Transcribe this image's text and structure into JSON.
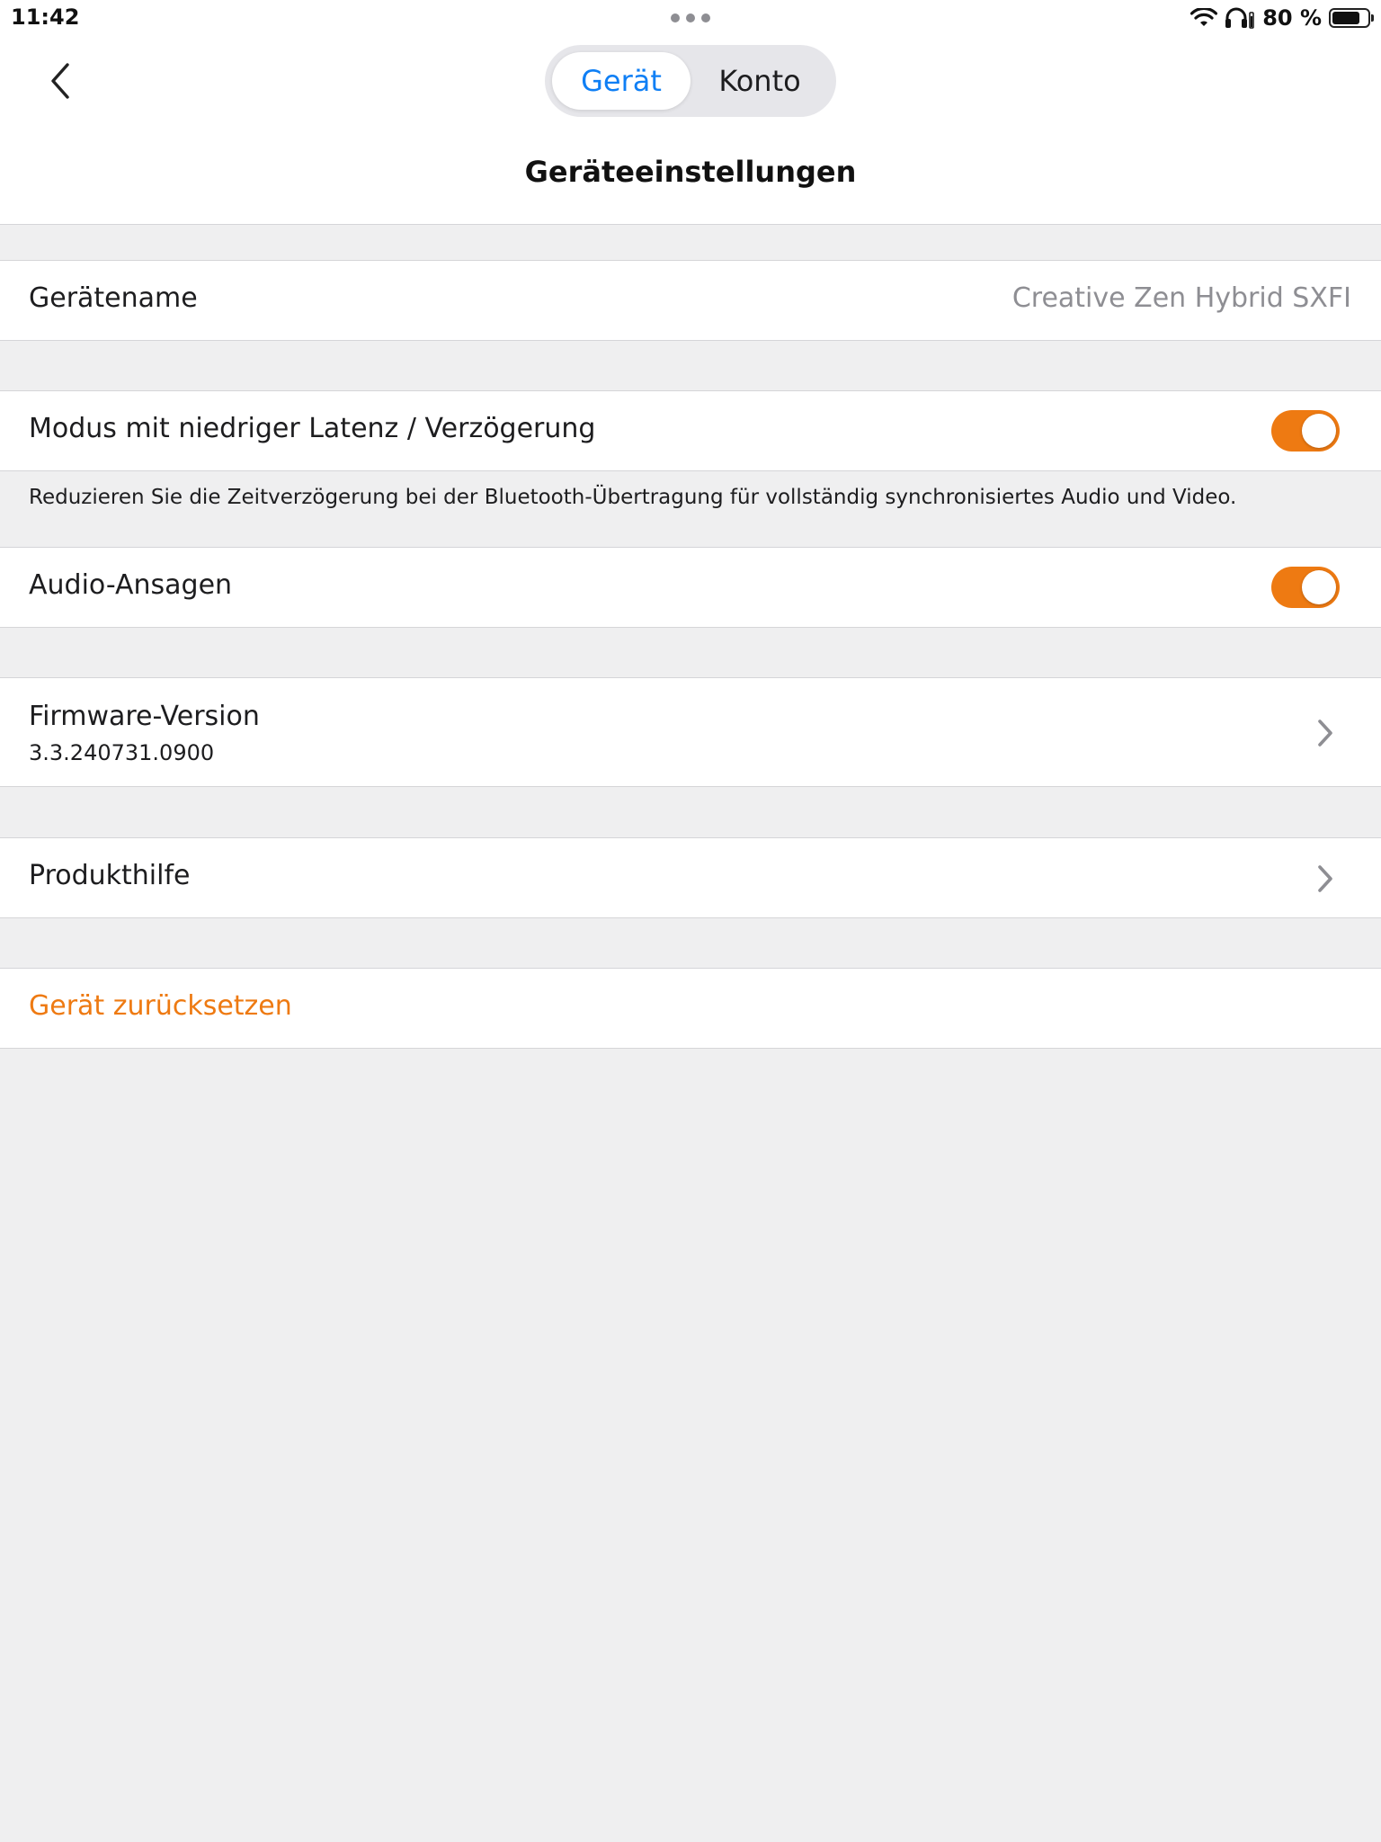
{
  "status_bar": {
    "time": "11:42",
    "battery_text": "80 %",
    "battery_level": 0.8,
    "icons": [
      "wifi-icon",
      "headphones-icon",
      "battery-icon"
    ]
  },
  "nav": {
    "back_icon": "chevron-left-icon",
    "tabs": [
      {
        "label": "Gerät",
        "active": true
      },
      {
        "label": "Konto",
        "active": false
      }
    ],
    "title": "Geräteeinstellungen"
  },
  "settings": {
    "device_name": {
      "label": "Gerätename",
      "value": "Creative Zen Hybrid SXFI"
    },
    "low_latency": {
      "label": "Modus mit niedriger Latenz / Verzögerung",
      "enabled": true,
      "description": "Reduzieren Sie die Zeitverzögerung bei der Bluetooth-Übertragung für vollständig synchronisiertes Audio und Video."
    },
    "audio_prompts": {
      "label": "Audio-Ansagen",
      "enabled": true
    },
    "firmware": {
      "label": "Firmware-Version",
      "value": "3.3.240731.0900"
    },
    "product_help": {
      "label": "Produkthilfe"
    },
    "reset": {
      "label": "Gerät zurücksetzen"
    }
  },
  "colors": {
    "accent_orange": "#ee7a12",
    "tab_active_blue": "#0f7ff5",
    "background": "#efeff0"
  }
}
